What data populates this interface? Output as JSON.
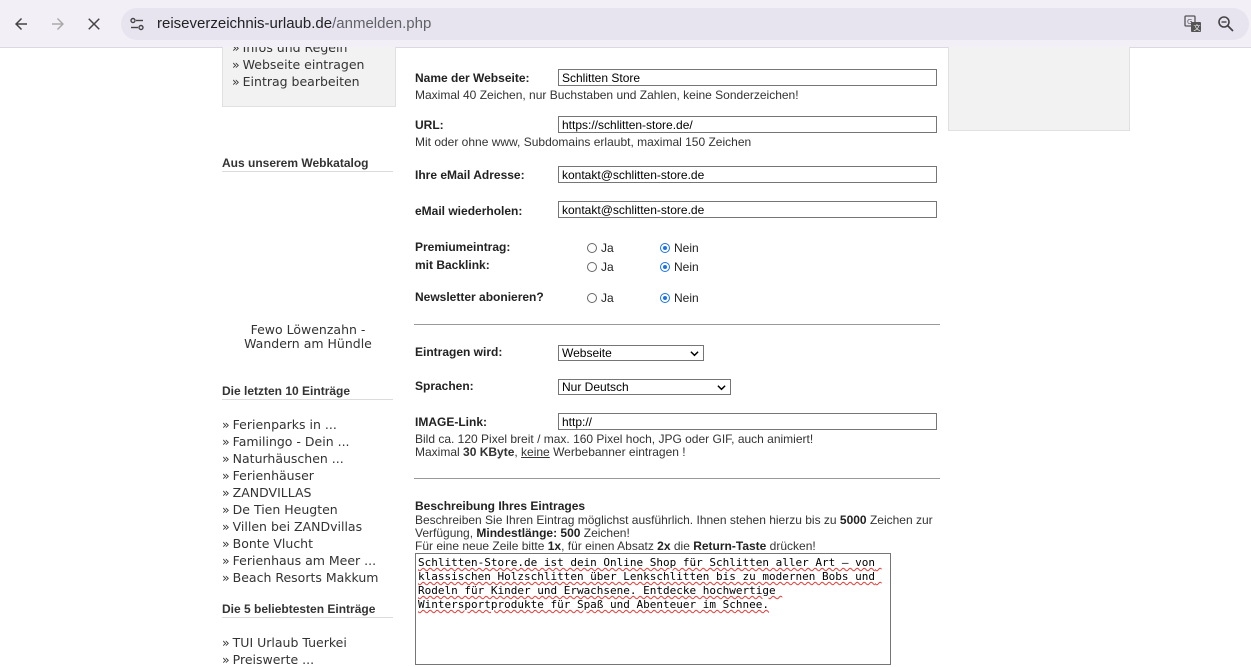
{
  "browser": {
    "url_domain": "reiseverzeichnis-urlaub.de",
    "url_path": "/anmelden.php"
  },
  "sidebar": {
    "top_links": [
      "Infos und Regeln",
      "Webseite eintragen",
      "Eintrag bearbeiten"
    ],
    "webkatalog_heading": "Aus unserem Webkatalog",
    "webkatalog_item": "Fewo Löwenzahn - Wandern am Hündle",
    "latest_heading": "Die letzten 10 Einträge",
    "latest_items": [
      "Ferienparks in ...",
      "Familingo - Dein ...",
      "Naturhäuschen ...",
      "Ferienhäuser",
      "ZANDVILLAS",
      "De Tien Heugten",
      "Villen bei ZANDvillas",
      "Bonte Vlucht",
      "Ferienhaus am Meer ...",
      "Beach Resorts Makkum"
    ],
    "popular_heading": "Die 5 beliebtesten Einträge",
    "popular_items": [
      "TUI Urlaub Tuerkei",
      "Preiswerte ..."
    ]
  },
  "form": {
    "name_label": "Name der Webseite:",
    "name_value": "Schlitten Store",
    "name_hint": "Maximal 40 Zeichen, nur Buchstaben und Zahlen, keine Sonderzeichen!",
    "url_label": "URL:",
    "url_value": "https://schlitten-store.de/",
    "url_hint": "Mit oder ohne www, Subdomains erlaubt, maximal 150 Zeichen",
    "email_label": "Ihre eMail Adresse:",
    "email_value": "kontakt@schlitten-store.de",
    "email_repeat_label": "eMail wiederholen:",
    "email_repeat_value": "kontakt@schlitten-store.de",
    "premium_label": "Premiumeintrag:",
    "backlink_label": "mit Backlink:",
    "newsletter_label": "Newsletter abonieren?",
    "yes": "Ja",
    "no": "Nein",
    "entry_label": "Eintragen wird:",
    "entry_value": "Webseite",
    "lang_label": "Sprachen:",
    "lang_value": "Nur Deutsch",
    "image_label": "IMAGE-Link:",
    "image_value": "http://",
    "image_hint1": "Bild ca. 120 Pixel breit / max. 160 Pixel hoch, JPG oder GIF, auch animiert!",
    "image_hint2_pre": "Maximal ",
    "image_hint2_bold": "30 KByte",
    "image_hint2_mid": ", ",
    "image_hint2_u": "keine",
    "image_hint2_post": " Werbebanner eintragen !",
    "desc_heading": "Beschreibung Ihres Eintrages",
    "desc_line1_pre": "Beschreiben Sie Ihren Eintrag möglichst ausführlich. Ihnen stehen hierzu bis zu ",
    "desc_line1_bold": "5000",
    "desc_line1_post": " Zeichen zur Verfügung, ",
    "desc_min_bold": "Mindestlänge: 500",
    "desc_min_post": " Zeichen!",
    "desc_line3_pre": "Für eine neue Zeile bitte ",
    "desc_line3_b1": "1x",
    "desc_line3_mid": ", für einen Absatz ",
    "desc_line3_b2": "2x",
    "desc_line3_mid2": " die ",
    "desc_line3_b3": "Return-Taste",
    "desc_line3_post": " drücken!",
    "desc_text": "Schlitten-Store.de ist dein Online Shop für Schlitten aller Art – von klassischen Holzschlitten über Lenkschlitten bis zu modernen Bobs und Rodeln für Kinder und Erwachsene. Entdecke hochwertige Wintersportprodukte für Spaß und Abenteuer im Schnee."
  }
}
